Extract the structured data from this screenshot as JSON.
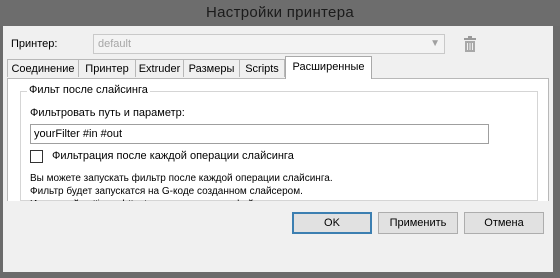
{
  "window": {
    "title": "Настройки принтера"
  },
  "printer": {
    "label": "Принтер:",
    "selected": "default",
    "dropdown_icon": "chevron-down-icon",
    "delete_icon": "trash-icon"
  },
  "tabs": [
    {
      "label": "Соединение"
    },
    {
      "label": "Принтер"
    },
    {
      "label": "Extruder"
    },
    {
      "label": "Размеры"
    },
    {
      "label": "Scripts"
    },
    {
      "label": "Расширенные",
      "active": true
    }
  ],
  "filter": {
    "group_title": "Фильт после слайсинга",
    "field_label": "Фильтровать путь и параметр:",
    "value": "yourFilter #in #out",
    "checkbox_label": "Фильтрация после каждой операции слайсинга",
    "checked": false,
    "info": [
      "Вы можете запускать фильтр после каждой операции слайсинга.",
      "Фильтр будет запускатся на G-коде созданном слайсером.",
      "Используйте #in and #out для вставки имен файлов ввода-вывода в качестве параметров."
    ]
  },
  "buttons": {
    "ok": "OK",
    "apply": "Применить",
    "cancel": "Отмена"
  }
}
